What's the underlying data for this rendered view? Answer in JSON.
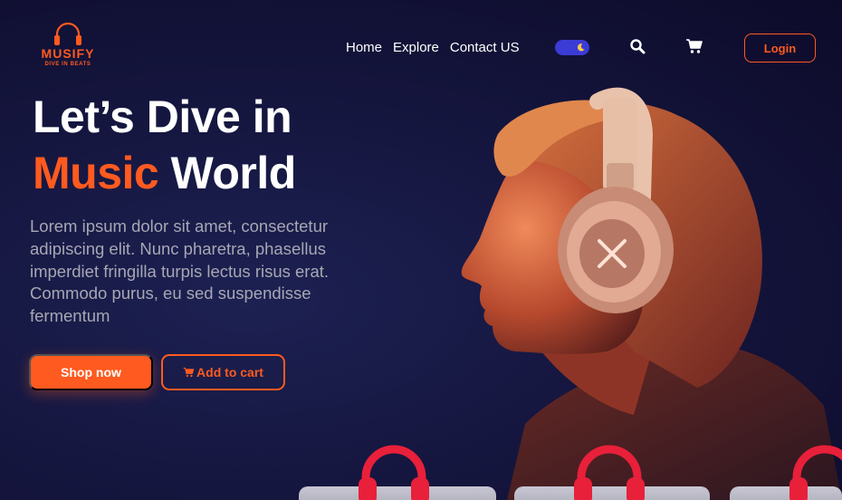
{
  "brand": {
    "name": "MUSIFY",
    "tagline": "DIVE IN BEATS",
    "logo_icon": "headphones-icon",
    "accent_color": "#ff5a1f"
  },
  "nav": {
    "items": [
      {
        "label": "Home"
      },
      {
        "label": "Explore"
      },
      {
        "label": "Contact US"
      }
    ]
  },
  "header": {
    "theme_toggle_icon": "moon-icon",
    "search_icon": "search-icon",
    "cart_icon": "cart-icon",
    "login_label": "Login"
  },
  "hero": {
    "title_line1": "Let’s Dive in",
    "title_accent": "Music",
    "title_rest": " World",
    "description": "Lorem ipsum dolor sit amet, consectetur adipiscing elit. Nunc pharetra, phasellus imperdiet fringilla turpis lectus risus erat. Commodo purus, eu sed suspendisse fermentum",
    "shop_label": "Shop now",
    "add_to_cart_label": "Add to cart",
    "image_alt": "man-with-headphones"
  },
  "colors": {
    "background": "#15163f",
    "accent": "#ff5a1f",
    "toggle": "#3b3bd6"
  }
}
